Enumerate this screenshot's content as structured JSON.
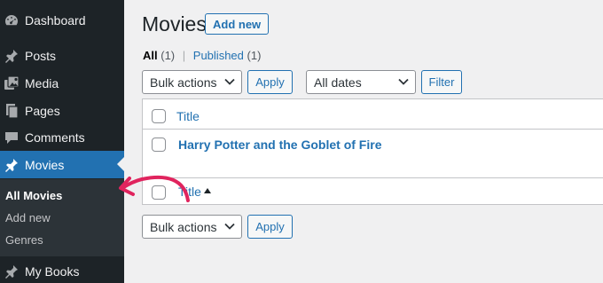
{
  "sidebar": {
    "dashboard": "Dashboard",
    "posts": "Posts",
    "media": "Media",
    "pages": "Pages",
    "comments": "Comments",
    "movies": "Movies",
    "submenu": {
      "all_movies": "All Movies",
      "add_new": "Add new",
      "genres": "Genres"
    },
    "my_books": "My Books"
  },
  "main": {
    "title": "Movies",
    "add_new_label": "Add new",
    "views": {
      "all_label": "All",
      "all_count": "(1)",
      "separator": "|",
      "published_label": "Published",
      "published_count": "(1)"
    },
    "top_nav": {
      "bulk_actions": "Bulk actions",
      "apply": "Apply",
      "dates": "All dates",
      "filter": "Filter"
    },
    "table": {
      "header_title": "Title",
      "rows": [
        {
          "title": "Harry Potter and the Goblet of Fire"
        }
      ],
      "footer_title": "Title"
    },
    "bottom_nav": {
      "bulk_actions": "Bulk actions",
      "apply": "Apply"
    }
  },
  "colors": {
    "sidebar_bg": "#1d2327",
    "submenu_bg": "#2c3338",
    "accent": "#2271b1",
    "annotation_arrow": "#e0245e",
    "page_bg": "#f0f0f1"
  },
  "icons": {
    "dashboard": "dashboard-icon",
    "posts": "pin-icon",
    "media": "media-icon",
    "pages": "pages-icon",
    "comments": "comment-icon",
    "movies": "pin-icon",
    "my_books": "pin-icon"
  }
}
